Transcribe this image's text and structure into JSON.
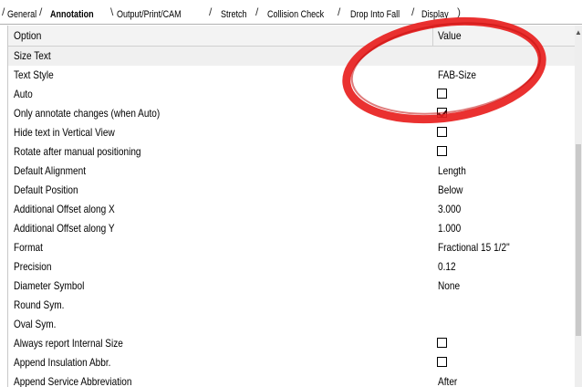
{
  "tabs": [
    {
      "label": "General",
      "active": false
    },
    {
      "label": "Annotation",
      "active": true
    },
    {
      "label": "Output/Print/CAM",
      "active": false
    },
    {
      "label": "Stretch",
      "active": false
    },
    {
      "label": "Collision Check",
      "active": false
    },
    {
      "label": "Drop Into Fall",
      "active": false
    },
    {
      "label": "Display",
      "active": false
    }
  ],
  "grid": {
    "header": {
      "option": "Option",
      "value": "Value"
    },
    "rows": [
      {
        "label": "Size Text",
        "type": "group"
      },
      {
        "label": "Text Style",
        "value": "FAB-Size"
      },
      {
        "label": "Auto",
        "checkbox": false
      },
      {
        "label": "Only annotate changes (when Auto)",
        "checkbox": true
      },
      {
        "label": "Hide text in Vertical View",
        "checkbox": false
      },
      {
        "label": "Rotate after manual positioning",
        "checkbox": false
      },
      {
        "label": "Default Alignment",
        "value": "Length"
      },
      {
        "label": "Default Position",
        "value": "Below"
      },
      {
        "label": "Additional Offset along X",
        "value": "3.000"
      },
      {
        "label": "Additional Offset along Y",
        "value": "1.000"
      },
      {
        "label": "Format",
        "value": "Fractional 15 1/2\""
      },
      {
        "label": "Precision",
        "value": "0.12"
      },
      {
        "label": "Diameter Symbol",
        "value": "None"
      },
      {
        "label": "Round Sym.",
        "value": ""
      },
      {
        "label": "Oval Sym.",
        "value": ""
      },
      {
        "label": "Always report Internal Size",
        "checkbox": false
      },
      {
        "label": "Append Insulation Abbr.",
        "checkbox": false
      },
      {
        "label": "Append Service Abbreviation",
        "value": "After"
      }
    ]
  },
  "colors": {
    "annotation_circle": "#e8201e"
  }
}
